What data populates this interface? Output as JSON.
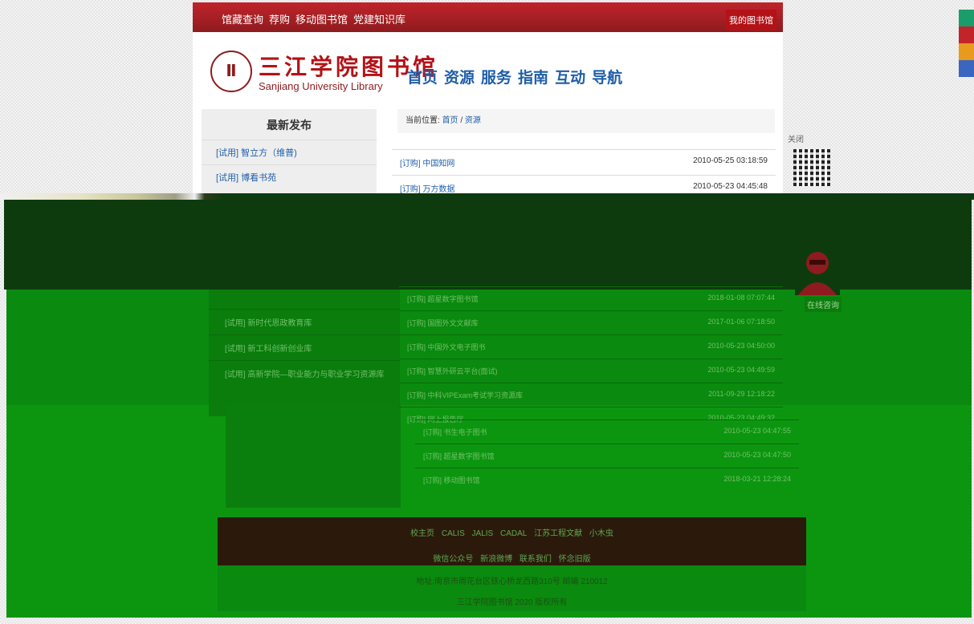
{
  "topbar": {
    "nav": [
      "馆藏查询",
      "荐购",
      "移动图书馆",
      "党建知识库"
    ],
    "my_library": "我的图书馆"
  },
  "logo": {
    "cn": "三江学院图书馆",
    "en": "Sanjiang University Library"
  },
  "main_nav": [
    "首页",
    "资源",
    "服务",
    "指南",
    "互动",
    "导航"
  ],
  "sidebar": {
    "title": "最新发布",
    "items": [
      "[试用] 智立方（维普)",
      "[试用] 博看书苑"
    ],
    "items_lower": [
      "[试用] 新时代思政教育库",
      "[试用] 新工科创新创业库",
      "[试用] 高新学院—职业能力与职业学习资源库"
    ]
  },
  "breadcrumb": {
    "label": "当前位置:",
    "home": "首页",
    "sep": "/",
    "current": "资源"
  },
  "list_top": [
    {
      "title": "[订购] 中国知网",
      "date": "2010-05-25 03:18:59"
    },
    {
      "title": "[订购] 万方数据",
      "date": "2010-05-23 04:45:48"
    }
  ],
  "list_green": [
    {
      "title": "[订购] 超星数字图书馆",
      "date": "2018-01-08 07:07:44"
    },
    {
      "title": "[订购] 国图外文文献库",
      "date": "2017-01-06 07:18:50"
    },
    {
      "title": "[订购] 中国外文电子图书",
      "date": "2010-05-23 04:50:00"
    },
    {
      "title": "[订购] 智慧外研云平台(面试)",
      "date": "2010-05-23 04:49:59"
    },
    {
      "title": "[订购] 中科VIPExam考试学习资源库",
      "date": "2011-09-29 12:18:22"
    },
    {
      "title": "[订购] 网上报告厅",
      "date": "2010-05-23 04:49:32"
    }
  ],
  "list_green2": [
    {
      "title": "[订购] 书生电子图书",
      "date": "2010-05-23 04:47:55"
    },
    {
      "title": "[订购] 超星数字图书馆",
      "date": "2010-05-23 04:47:50"
    },
    {
      "title": "[订购] 移动图书馆",
      "date": "2018-03-21 12:28:24"
    }
  ],
  "qr": {
    "close": "关闭"
  },
  "online": "在线咨询",
  "footer": {
    "links1": [
      "校主页",
      "CALIS",
      "JALIS",
      "CADAL",
      "江苏工程文献",
      "小木虫"
    ],
    "links2": [
      "微信公众号",
      "新浪微博",
      "联系我们",
      "怀念旧版"
    ],
    "address": "地址:南京市雨花台区铁心桥龙西路310号 邮编 210012",
    "copyright": "三江学院图书馆 2020 版权所有"
  },
  "colors": {
    "accent_red": "#b31217",
    "link_blue": "#1f5ea8",
    "overlay_green": "#0a8a0e"
  }
}
